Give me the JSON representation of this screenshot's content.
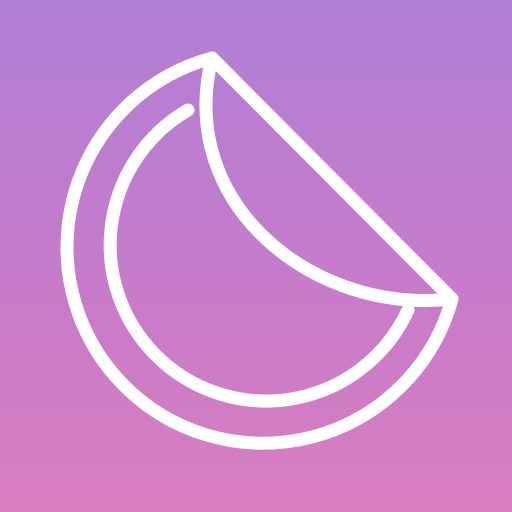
{
  "icon": {
    "name": "sticker-icon",
    "colors": {
      "gradient_top": "#b07fd6",
      "gradient_mid": "#c77bca",
      "gradient_bottom": "#d87ec0",
      "stroke": "#ffffff"
    }
  }
}
